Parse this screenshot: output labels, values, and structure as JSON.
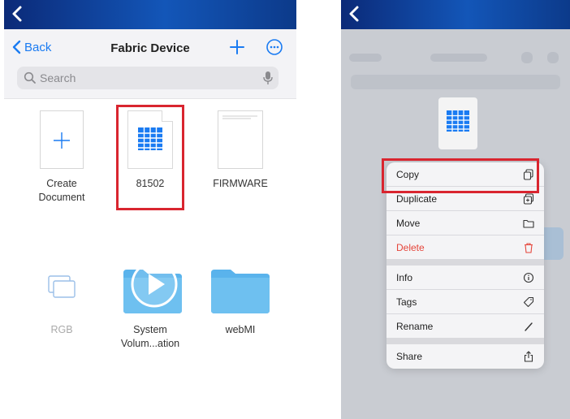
{
  "left_screen": {
    "nav": {
      "back_label": "Back",
      "title": "Fabric Device"
    },
    "search": {
      "placeholder": "Search"
    },
    "files": [
      {
        "label": "Create\nDocument"
      },
      {
        "label": "81502"
      },
      {
        "label": "FIRMWARE"
      },
      {
        "label": "RGB"
      },
      {
        "label": "System\nVolum...ation"
      },
      {
        "label": "webMI"
      }
    ]
  },
  "right_screen": {
    "menu": {
      "copy": "Copy",
      "duplicate": "Duplicate",
      "move": "Move",
      "delete": "Delete",
      "info": "Info",
      "tags": "Tags",
      "rename": "Rename",
      "share": "Share"
    }
  },
  "colors": {
    "accent": "#1a7bf2",
    "highlight": "#d9252f",
    "folder": "#5ab3ec",
    "danger": "#e5453a"
  }
}
